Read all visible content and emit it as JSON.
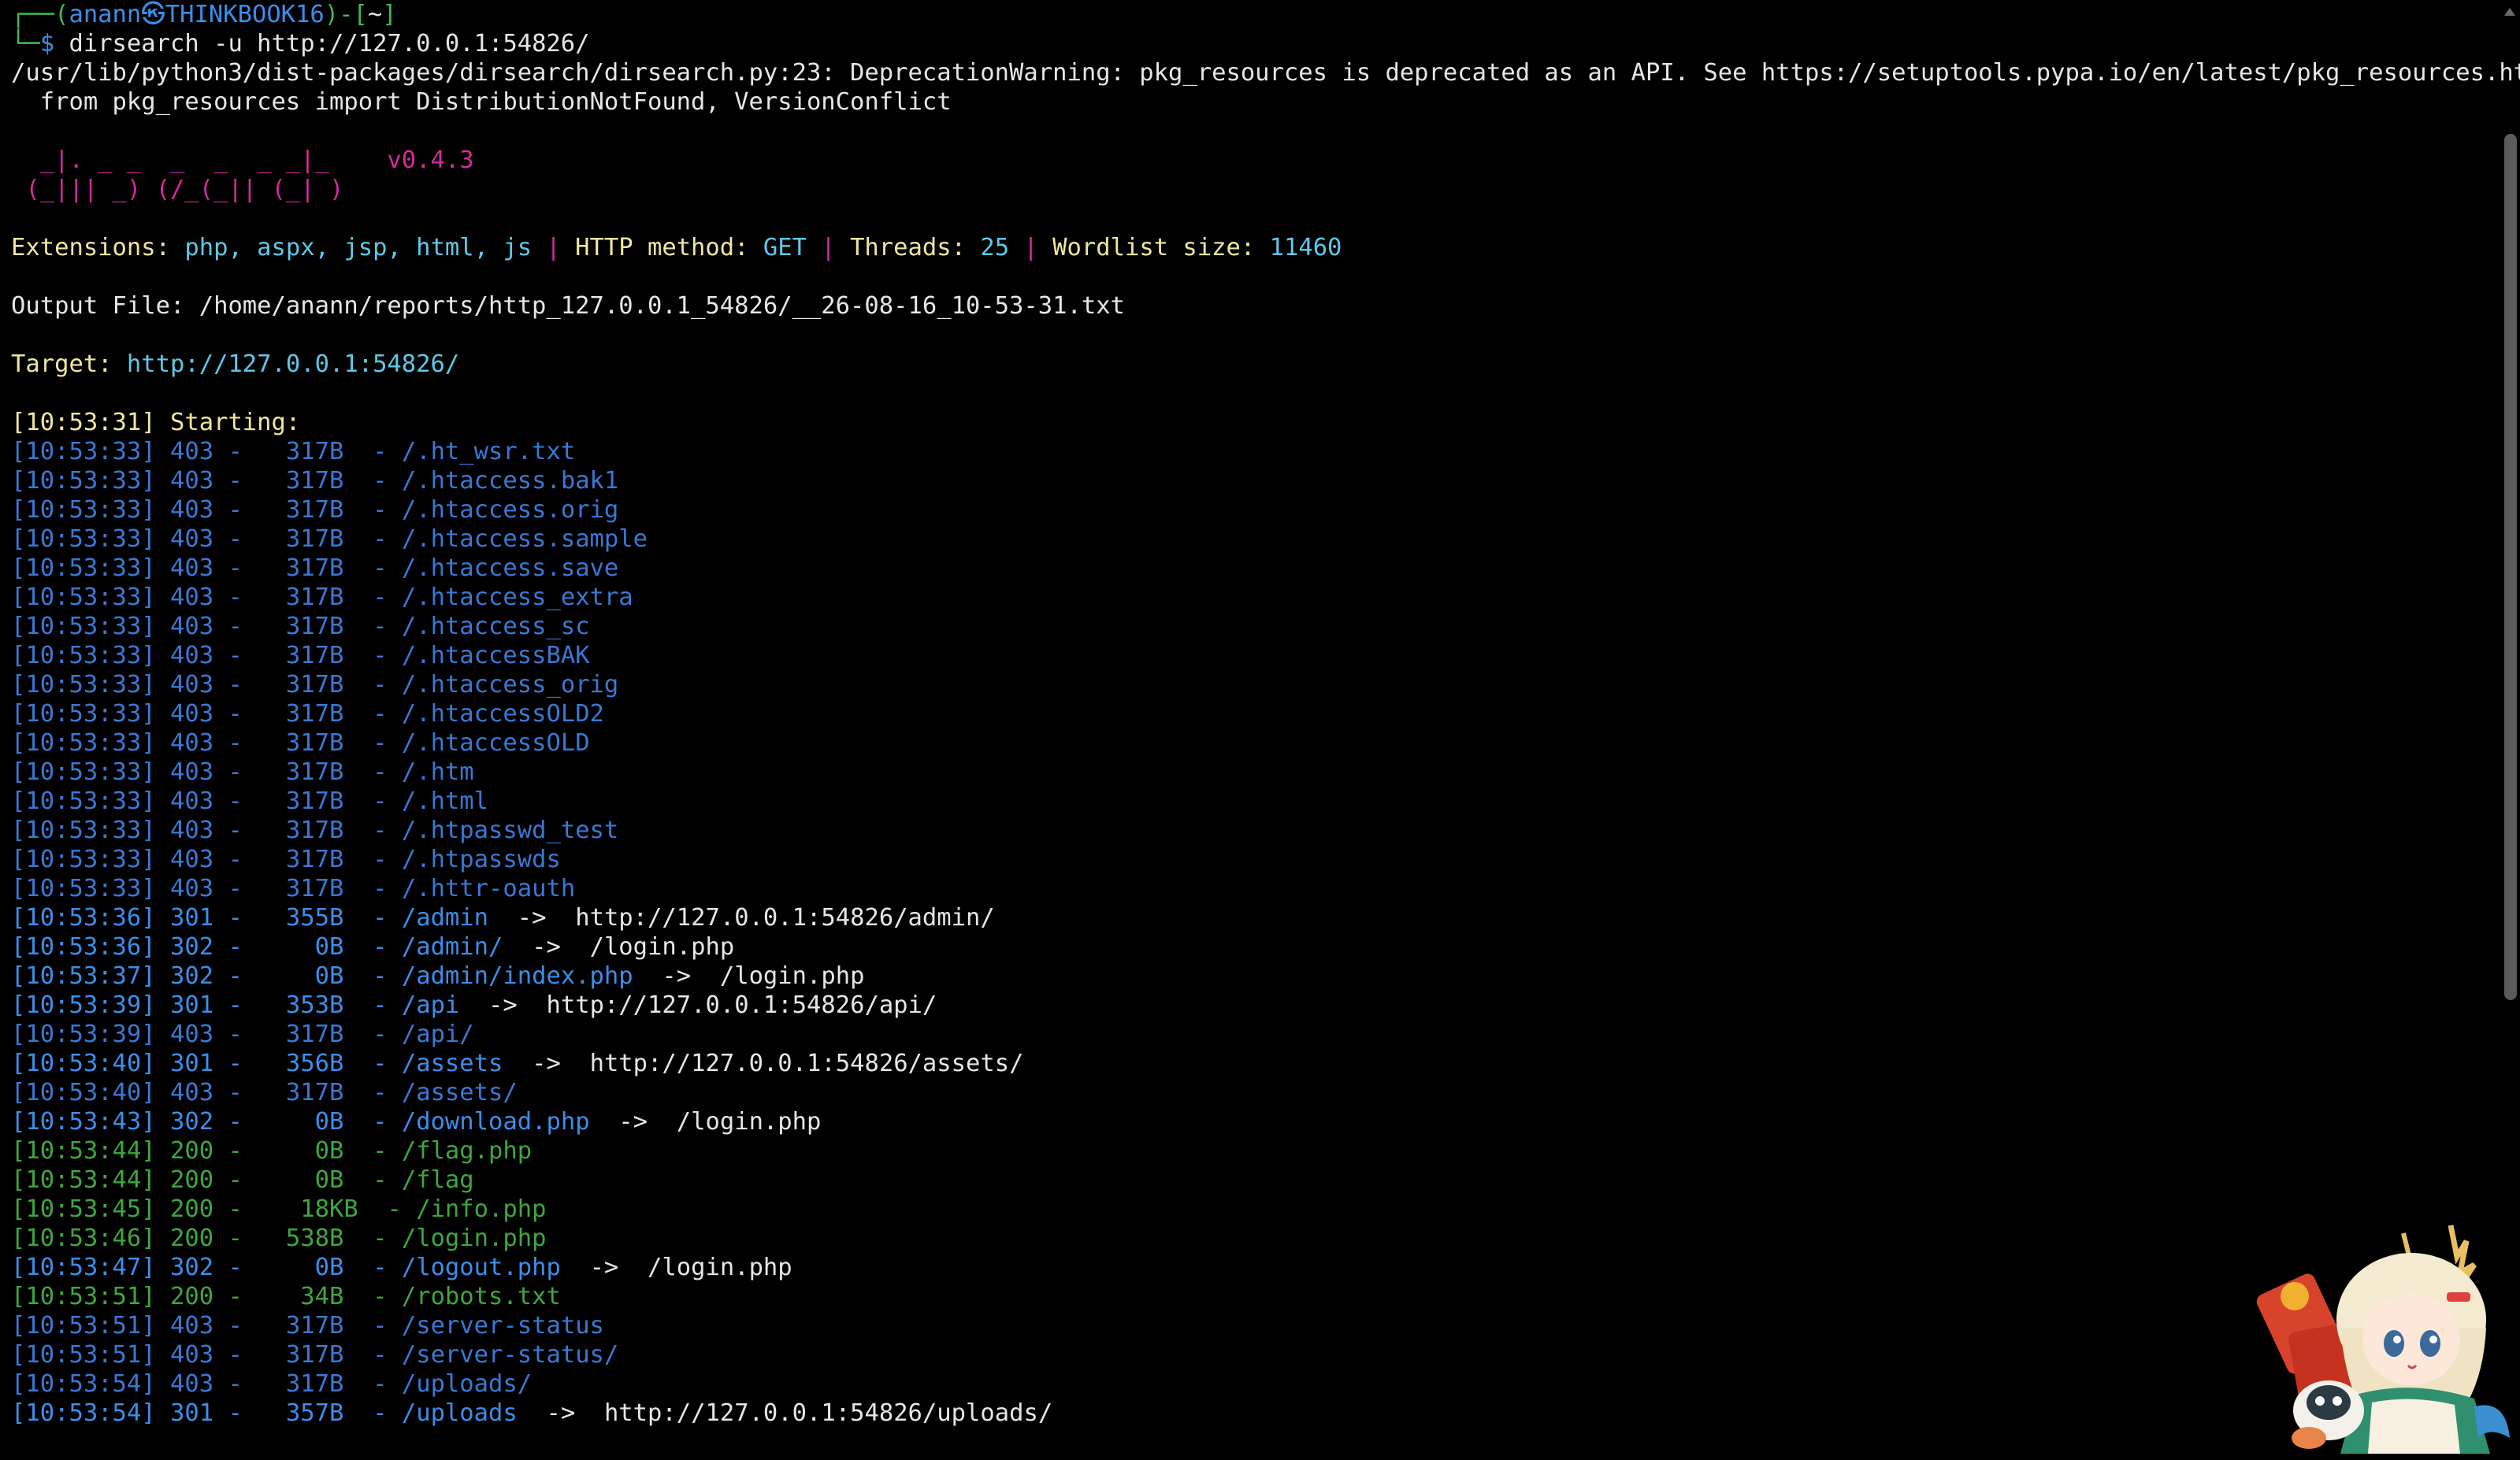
{
  "prompt": {
    "corner_top": "┌──(",
    "user": "anann",
    "skull": "㉿",
    "host": "THINKBOOK16",
    "mid": ")-[",
    "dir": "~",
    "end": "]",
    "corner_bottom": "└─",
    "dollar": "$",
    "command": " dirsearch -u http://127.0.0.1:54826/"
  },
  "warning": {
    "line1": "/usr/lib/python3/dist-packages/dirsearch/dirsearch.py:23: DeprecationWarning: pkg_resources is deprecated as an API. See https://setuptools.pypa.io/en/latest/pkg_resources.html",
    "line2": "  from pkg_resources import DistributionNotFound, VersionConflict"
  },
  "banner": {
    "line1": "  _|. _ _  _  _  _ _|_    v0.4.3",
    "line2": " (_||| _) (/_(_|| (_| )"
  },
  "config": {
    "extensions_label": "Extensions: ",
    "extensions_value": "php, aspx, jsp, html, js",
    "sep": " | ",
    "method_label": "HTTP method: ",
    "method_value": "GET",
    "threads_label": "Threads: ",
    "threads_value": "25",
    "wordlist_label": "Wordlist size: ",
    "wordlist_value": "11460"
  },
  "output_file": "Output File: /home/anann/reports/http_127.0.0.1_54826/__26-08-16_10-53-31.txt",
  "target": {
    "label": "Target: ",
    "value": "http://127.0.0.1:54826/"
  },
  "starting": "[10:53:31] Starting: ",
  "results": [
    {
      "time": "[10:53:33]",
      "code": "403",
      "size": "  317B",
      "path": "/.ht_wsr.txt",
      "redirect": ""
    },
    {
      "time": "[10:53:33]",
      "code": "403",
      "size": "  317B",
      "path": "/.htaccess.bak1",
      "redirect": ""
    },
    {
      "time": "[10:53:33]",
      "code": "403",
      "size": "  317B",
      "path": "/.htaccess.orig",
      "redirect": ""
    },
    {
      "time": "[10:53:33]",
      "code": "403",
      "size": "  317B",
      "path": "/.htaccess.sample",
      "redirect": ""
    },
    {
      "time": "[10:53:33]",
      "code": "403",
      "size": "  317B",
      "path": "/.htaccess.save",
      "redirect": ""
    },
    {
      "time": "[10:53:33]",
      "code": "403",
      "size": "  317B",
      "path": "/.htaccess_extra",
      "redirect": ""
    },
    {
      "time": "[10:53:33]",
      "code": "403",
      "size": "  317B",
      "path": "/.htaccess_sc",
      "redirect": ""
    },
    {
      "time": "[10:53:33]",
      "code": "403",
      "size": "  317B",
      "path": "/.htaccessBAK",
      "redirect": ""
    },
    {
      "time": "[10:53:33]",
      "code": "403",
      "size": "  317B",
      "path": "/.htaccess_orig",
      "redirect": ""
    },
    {
      "time": "[10:53:33]",
      "code": "403",
      "size": "  317B",
      "path": "/.htaccessOLD2",
      "redirect": ""
    },
    {
      "time": "[10:53:33]",
      "code": "403",
      "size": "  317B",
      "path": "/.htaccessOLD",
      "redirect": ""
    },
    {
      "time": "[10:53:33]",
      "code": "403",
      "size": "  317B",
      "path": "/.htm",
      "redirect": ""
    },
    {
      "time": "[10:53:33]",
      "code": "403",
      "size": "  317B",
      "path": "/.html",
      "redirect": ""
    },
    {
      "time": "[10:53:33]",
      "code": "403",
      "size": "  317B",
      "path": "/.htpasswd_test",
      "redirect": ""
    },
    {
      "time": "[10:53:33]",
      "code": "403",
      "size": "  317B",
      "path": "/.htpasswds",
      "redirect": ""
    },
    {
      "time": "[10:53:33]",
      "code": "403",
      "size": "  317B",
      "path": "/.httr-oauth",
      "redirect": ""
    },
    {
      "time": "[10:53:36]",
      "code": "301",
      "size": "  355B",
      "path": "/admin",
      "redirect": "http://127.0.0.1:54826/admin/"
    },
    {
      "time": "[10:53:36]",
      "code": "302",
      "size": "    0B",
      "path": "/admin/",
      "redirect": "/login.php"
    },
    {
      "time": "[10:53:37]",
      "code": "302",
      "size": "    0B",
      "path": "/admin/index.php",
      "redirect": "/login.php"
    },
    {
      "time": "[10:53:39]",
      "code": "301",
      "size": "  353B",
      "path": "/api",
      "redirect": "http://127.0.0.1:54826/api/"
    },
    {
      "time": "[10:53:39]",
      "code": "403",
      "size": "  317B",
      "path": "/api/",
      "redirect": ""
    },
    {
      "time": "[10:53:40]",
      "code": "301",
      "size": "  356B",
      "path": "/assets",
      "redirect": "http://127.0.0.1:54826/assets/"
    },
    {
      "time": "[10:53:40]",
      "code": "403",
      "size": "  317B",
      "path": "/assets/",
      "redirect": ""
    },
    {
      "time": "[10:53:43]",
      "code": "302",
      "size": "    0B",
      "path": "/download.php",
      "redirect": "/login.php"
    },
    {
      "time": "[10:53:44]",
      "code": "200",
      "size": "    0B",
      "path": "/flag.php",
      "redirect": ""
    },
    {
      "time": "[10:53:44]",
      "code": "200",
      "size": "    0B",
      "path": "/flag",
      "redirect": ""
    },
    {
      "time": "[10:53:45]",
      "code": "200",
      "size": "   18KB",
      "path": "/info.php",
      "redirect": ""
    },
    {
      "time": "[10:53:46]",
      "code": "200",
      "size": "  538B",
      "path": "/login.php",
      "redirect": ""
    },
    {
      "time": "[10:53:47]",
      "code": "302",
      "size": "    0B",
      "path": "/logout.php",
      "redirect": "/login.php"
    },
    {
      "time": "[10:53:51]",
      "code": "200",
      "size": "   34B",
      "path": "/robots.txt",
      "redirect": ""
    },
    {
      "time": "[10:53:51]",
      "code": "403",
      "size": "  317B",
      "path": "/server-status",
      "redirect": ""
    },
    {
      "time": "[10:53:51]",
      "code": "403",
      "size": "  317B",
      "path": "/server-status/",
      "redirect": ""
    },
    {
      "time": "[10:53:54]",
      "code": "403",
      "size": "  317B",
      "path": "/uploads/",
      "redirect": ""
    },
    {
      "time": "[10:53:54]",
      "code": "301",
      "size": "  357B",
      "path": "/uploads",
      "redirect": "http://127.0.0.1:54826/uploads/"
    }
  ],
  "colors": {
    "c301_302": "#3b8eea",
    "c403": "#3a78d4",
    "c200": "#3fa63f",
    "redirect": "#e6e6e6"
  },
  "icons": {
    "mascot": "anime-mascot-sticker-icon"
  }
}
